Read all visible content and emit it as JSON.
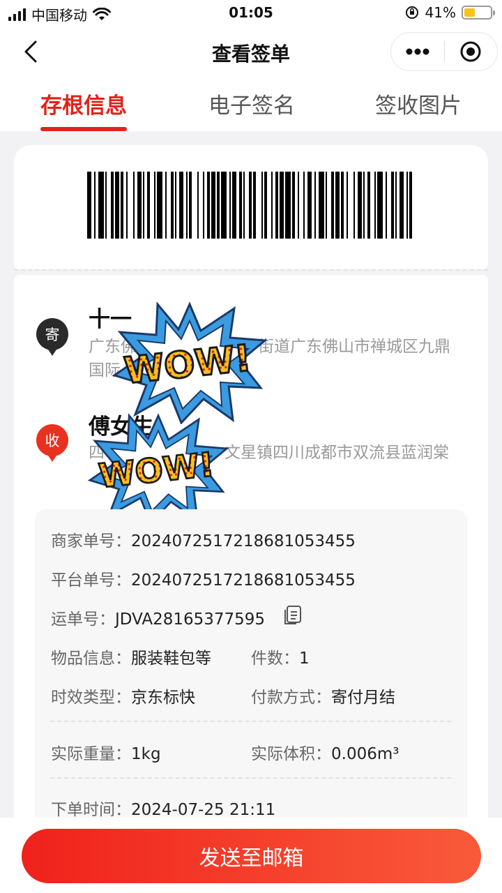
{
  "status_bar": {
    "carrier": "中国移动",
    "time": "01:05",
    "battery": "41%",
    "icons": [
      "signal-icon",
      "wifi-icon",
      "orientation-lock-icon",
      "battery-icon"
    ]
  },
  "navbar": {
    "title": "查看签单",
    "icons": [
      "back-icon",
      "more-icon",
      "target-icon"
    ]
  },
  "tabs": [
    {
      "label": "存根信息",
      "active": true
    },
    {
      "label": "电子签名",
      "active": false
    },
    {
      "label": "签收图片",
      "active": false
    }
  ],
  "sender": {
    "badge": "寄",
    "name": "十一",
    "address_line1": "广东佛",
    "address_line1_right": "街道广东佛山市禅城区九鼎",
    "address_line2": "国际"
  },
  "receiver": {
    "badge": "收",
    "name": "傅女生",
    "address_line1": "四",
    "address_line1_right": "文星镇四川成都市双流县蓝润棠"
  },
  "info": {
    "merchant_no_label": "商家单号：",
    "merchant_no": "202407251721868105​3455",
    "platform_no_label": "平台单号：",
    "platform_no": "202407251721868105​3455",
    "waybill_label": "运单号：",
    "waybill": "JDVA28165377595",
    "goods_label": "物品信息：",
    "goods": "服装鞋包等",
    "count_label": "件数：",
    "count": "1",
    "timeliness_label": "时效类型：",
    "timeliness": "京东标快",
    "payment_label": "付款方式：",
    "payment": "寄付月结",
    "weight_label": "实际重量：",
    "weight": "1kg",
    "volume_label": "实际体积：",
    "volume": "0.006m³",
    "order_time_label": "下单时间：",
    "order_time": "2024-07-25 21:11"
  },
  "stickers": {
    "text": "WOW!",
    "colors": {
      "burst": "#3a9be0",
      "letters": "#f6c21c",
      "dots": "#e2231a"
    }
  },
  "bottom": {
    "send_label": "发送至邮箱"
  },
  "colors": {
    "accent": "#e2231a",
    "background": "#f2f2f4"
  }
}
